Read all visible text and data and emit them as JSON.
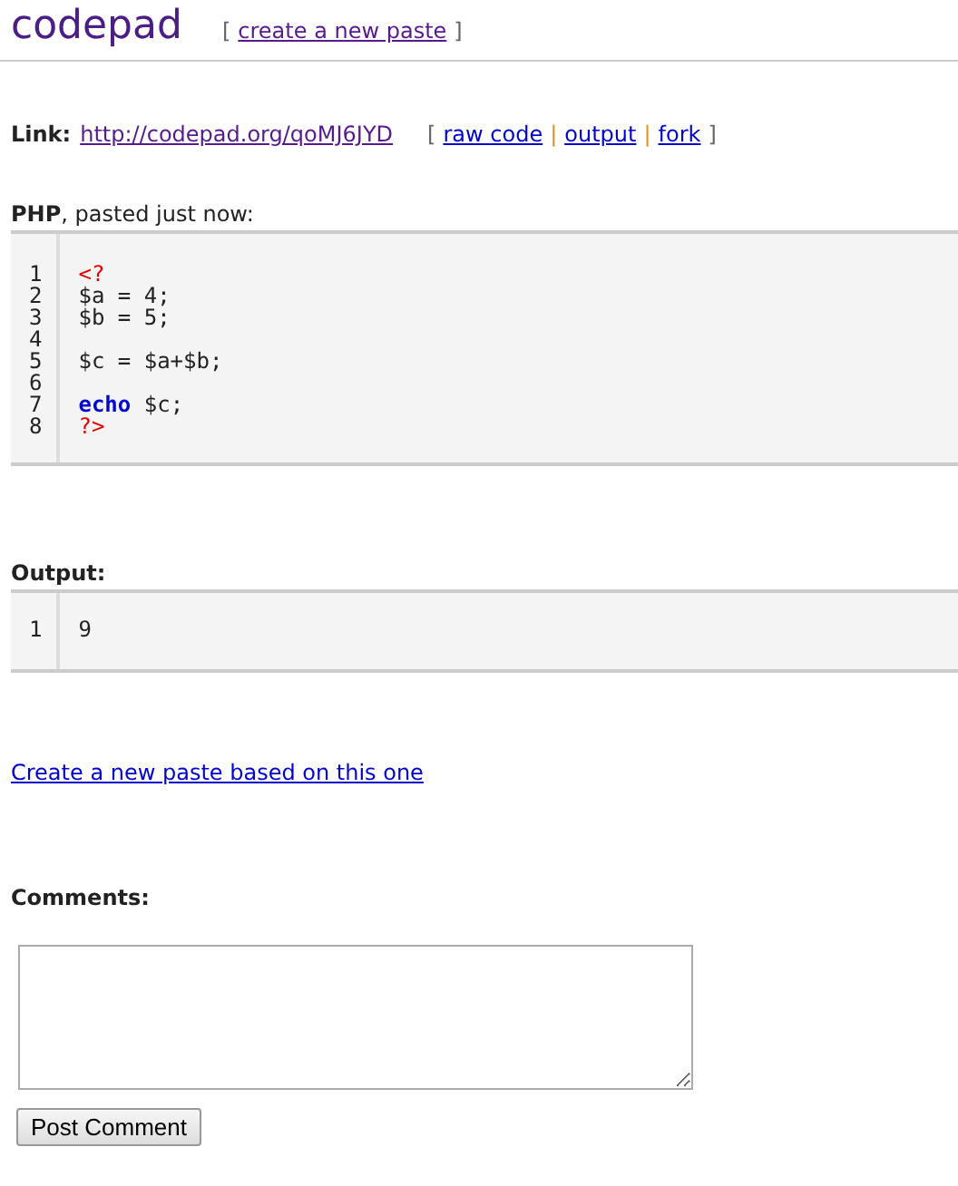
{
  "header": {
    "logo": "codepad",
    "nav": [
      {
        "kind": "bracket",
        "text": "["
      },
      {
        "kind": "link",
        "text": "create a new paste"
      },
      {
        "kind": "bracket",
        "text": "]"
      }
    ]
  },
  "link_row": {
    "label": "Link:",
    "url": "http://codepad.org/qoMJ6JYD",
    "actions": [
      {
        "kind": "bracket",
        "text": "["
      },
      {
        "kind": "link",
        "text": "raw code"
      },
      {
        "kind": "separator",
        "text": "|"
      },
      {
        "kind": "link",
        "text": "output"
      },
      {
        "kind": "separator",
        "text": "|"
      },
      {
        "kind": "link",
        "text": "fork"
      },
      {
        "kind": "bracket",
        "text": "]"
      }
    ]
  },
  "code": {
    "language": "PHP",
    "caption": ", pasted just now:",
    "lines": [
      {
        "number": "1",
        "tokens": [
          {
            "kind": "tag",
            "text": "<?"
          }
        ]
      },
      {
        "number": "2",
        "tokens": [
          {
            "kind": "plain",
            "text": "$a = 4;"
          }
        ]
      },
      {
        "number": "3",
        "tokens": [
          {
            "kind": "plain",
            "text": "$b = 5;"
          }
        ]
      },
      {
        "number": "4"
      },
      {
        "number": "5",
        "tokens": [
          {
            "kind": "plain",
            "text": "$c = $a+$b;"
          }
        ]
      },
      {
        "number": "6"
      },
      {
        "number": "7",
        "tokens": [
          {
            "kind": "keyword",
            "text": "echo"
          },
          {
            "kind": "plain",
            "text": " $c;"
          }
        ]
      },
      {
        "number": "8",
        "tokens": [
          {
            "kind": "tag",
            "text": "?>"
          }
        ]
      }
    ]
  },
  "output": {
    "label": "Output:",
    "lines": [
      {
        "number": "1",
        "text": "9"
      }
    ]
  },
  "fork_link": "Create a new paste based on this one",
  "comments": {
    "label": "Comments:",
    "button": "Post Comment"
  }
}
